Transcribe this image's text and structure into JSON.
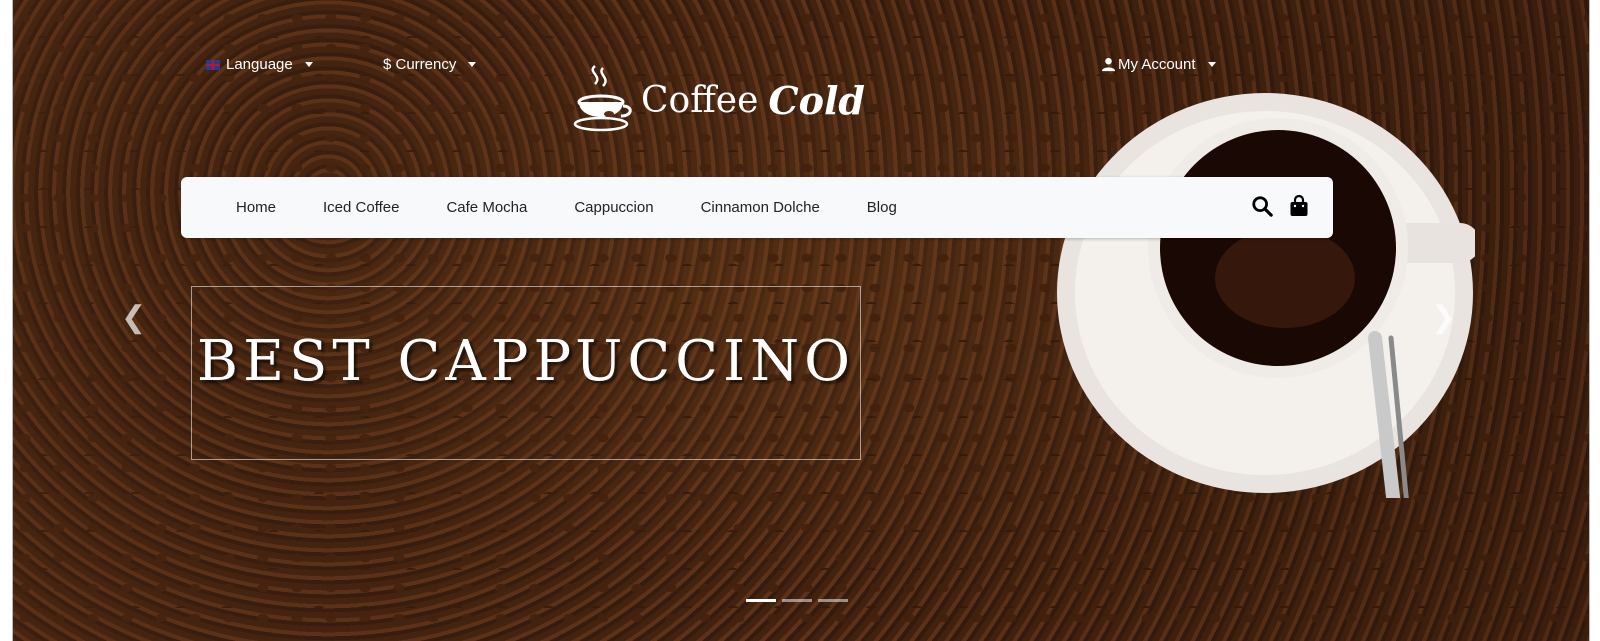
{
  "top": {
    "language_label": "Language",
    "currency_label": "$ Currency",
    "account_label": "My Account"
  },
  "brand": {
    "word1": "Coffee",
    "word2": "Cold"
  },
  "nav": {
    "items": [
      "Home",
      "Iced Coffee",
      "Cafe Mocha",
      "Cappuccion",
      "Cinnamon Dolche",
      "Blog"
    ],
    "icons": [
      "search-icon",
      "shopping-bag-icon"
    ]
  },
  "hero": {
    "headline": "BEST CAPPUCCINO",
    "slides": 3,
    "active_slide": 1
  },
  "colors": {
    "nav_bg": "#f8f9fa",
    "text_on_dark": "#ffffff",
    "coffee_brown": "#4a2814"
  }
}
